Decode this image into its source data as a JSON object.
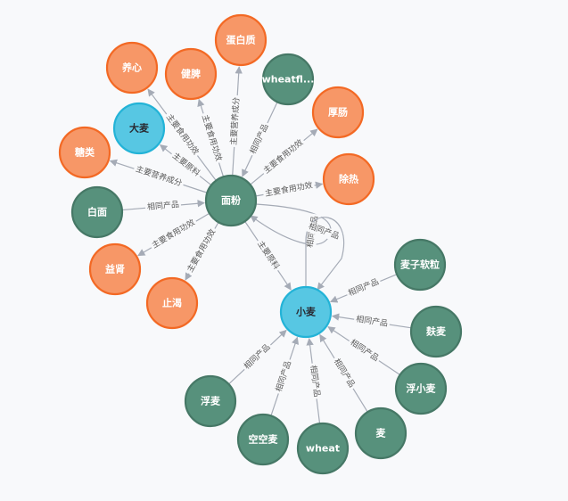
{
  "graph": {
    "colors": {
      "background": "#f8f9fb",
      "edge": "#a5abb6",
      "edge_label": "#5a5a5a",
      "categories": {
        "product": {
          "fill": "#57917c",
          "stroke": "#467866",
          "text": "#ffffff"
        },
        "attribute": {
          "fill": "#f79767",
          "stroke": "#f36924",
          "text": "#ffffff"
        },
        "focus": {
          "fill": "#57c7e3",
          "stroke": "#23b3d7",
          "text": "#2a2c34"
        }
      }
    },
    "nodes": [
      {
        "id": "mianfen",
        "label": "面粉",
        "category": "product"
      },
      {
        "id": "xiaomai",
        "label": "小麦",
        "category": "focus"
      },
      {
        "id": "damai",
        "label": "大麦",
        "category": "focus"
      },
      {
        "id": "danbaizhi",
        "label": "蛋白质",
        "category": "attribute"
      },
      {
        "id": "yangxin",
        "label": "养心",
        "category": "attribute"
      },
      {
        "id": "jianpi",
        "label": "健脾",
        "category": "attribute"
      },
      {
        "id": "wheatflour",
        "label": "wheatfl...",
        "category": "product"
      },
      {
        "id": "houchang",
        "label": "厚肠",
        "category": "attribute"
      },
      {
        "id": "tanglei",
        "label": "糖类",
        "category": "attribute"
      },
      {
        "id": "chure",
        "label": "除热",
        "category": "attribute"
      },
      {
        "id": "baimian",
        "label": "白面",
        "category": "product"
      },
      {
        "id": "yishen",
        "label": "益肾",
        "category": "attribute"
      },
      {
        "id": "zhike",
        "label": "止渴",
        "category": "attribute"
      },
      {
        "id": "maiziruanli",
        "label": "麦子软粒",
        "category": "product"
      },
      {
        "id": "fumai2",
        "label": "麸麦",
        "category": "product"
      },
      {
        "id": "fuxiaomai",
        "label": "浮小麦",
        "category": "product"
      },
      {
        "id": "mai",
        "label": "麦",
        "category": "product"
      },
      {
        "id": "wheat",
        "label": "wheat",
        "category": "product"
      },
      {
        "id": "kongkongmai",
        "label": "空空麦",
        "category": "product"
      },
      {
        "id": "fumai",
        "label": "浮麦",
        "category": "product"
      }
    ],
    "edges": [
      {
        "source": "mianfen",
        "target": "danbaizhi",
        "label": "主要营养成分"
      },
      {
        "source": "mianfen",
        "target": "yangxin",
        "label": "主要食用功效"
      },
      {
        "source": "mianfen",
        "target": "jianpi",
        "label": "主要食用功效"
      },
      {
        "source": "wheatflour",
        "target": "mianfen",
        "label": "相同产品"
      },
      {
        "source": "mianfen",
        "target": "houchang",
        "label": "主要食用功效"
      },
      {
        "source": "mianfen",
        "target": "damai",
        "label": "主要原料"
      },
      {
        "source": "mianfen",
        "target": "tanglei",
        "label": "主要营养成分"
      },
      {
        "source": "mianfen",
        "target": "chure",
        "label": "主要食用功效"
      },
      {
        "source": "baimian",
        "target": "mianfen",
        "label": "相同产品"
      },
      {
        "source": "mianfen",
        "target": "yishen",
        "label": "主要食用功效"
      },
      {
        "source": "mianfen",
        "target": "zhike",
        "label": "主要食用功效"
      },
      {
        "source": "mianfen",
        "target": "xiaomai",
        "label": "主要原料"
      },
      {
        "source": "xiaomai",
        "target": "mianfen",
        "label": "相同产品",
        "curved": true
      },
      {
        "source": "xiaomai",
        "target": "xiaomai",
        "label": "相同产品",
        "loop": true
      },
      {
        "source": "maiziruanli",
        "target": "xiaomai",
        "label": "相同产品"
      },
      {
        "source": "fumai2",
        "target": "xiaomai",
        "label": "相同产品"
      },
      {
        "source": "fuxiaomai",
        "target": "xiaomai",
        "label": "相同产品"
      },
      {
        "source": "mai",
        "target": "xiaomai",
        "label": "相同产品"
      },
      {
        "source": "wheat",
        "target": "xiaomai",
        "label": "相同产品"
      },
      {
        "source": "kongkongmai",
        "target": "xiaomai",
        "label": "相同产品"
      },
      {
        "source": "fumai",
        "target": "xiaomai",
        "label": "相同产品"
      }
    ]
  }
}
